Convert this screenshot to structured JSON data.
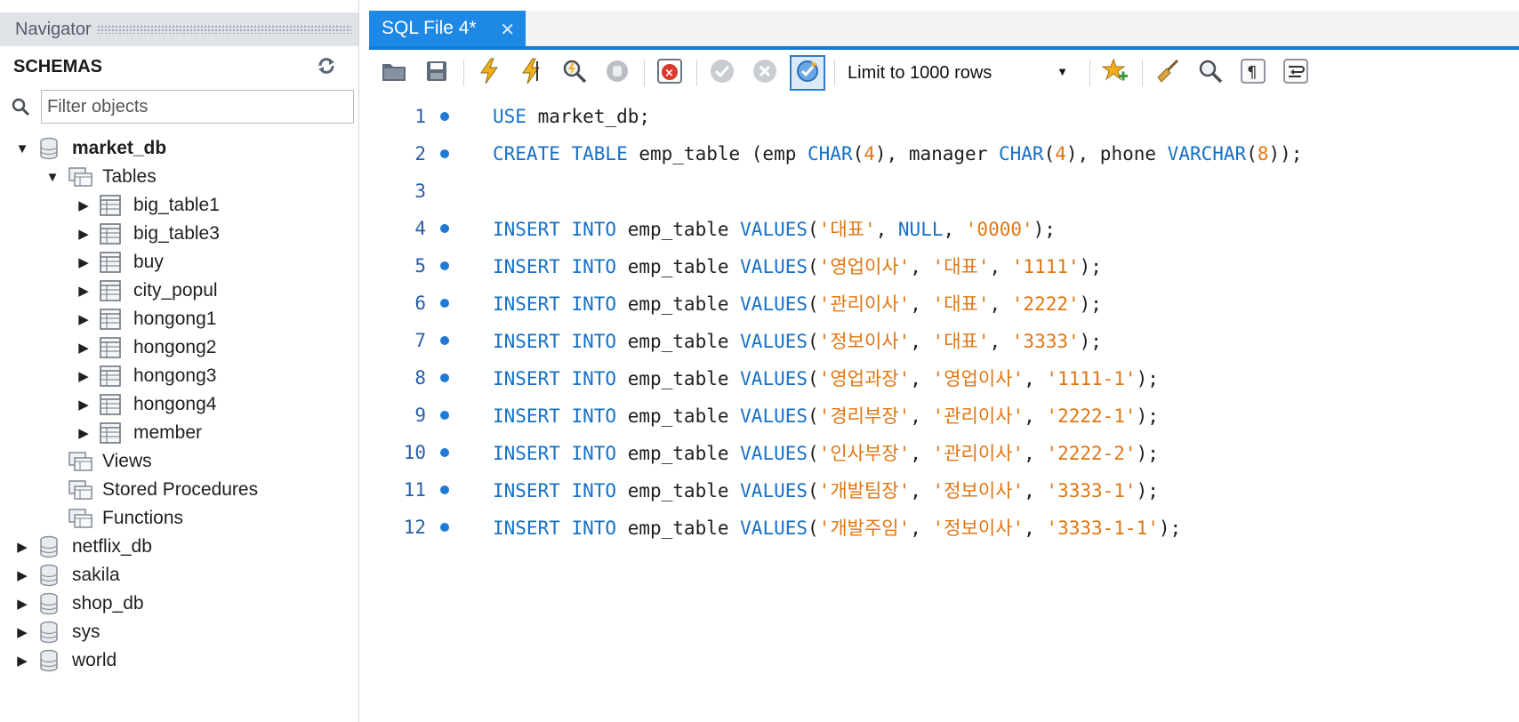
{
  "navigator": {
    "title": "Navigator",
    "schemas_label": "SCHEMAS",
    "filter_placeholder": "Filter objects",
    "tree": [
      {
        "label": "market_db",
        "level": 0,
        "type": "db",
        "expanded": true,
        "bold": true
      },
      {
        "label": "Tables",
        "level": 1,
        "type": "folder",
        "expanded": true
      },
      {
        "label": "big_table1",
        "level": 2,
        "type": "table",
        "expanded": false
      },
      {
        "label": "big_table3",
        "level": 2,
        "type": "table",
        "expanded": false
      },
      {
        "label": "buy",
        "level": 2,
        "type": "table",
        "expanded": false
      },
      {
        "label": "city_popul",
        "level": 2,
        "type": "table",
        "expanded": false
      },
      {
        "label": "hongong1",
        "level": 2,
        "type": "table",
        "expanded": false
      },
      {
        "label": "hongong2",
        "level": 2,
        "type": "table",
        "expanded": false
      },
      {
        "label": "hongong3",
        "level": 2,
        "type": "table",
        "expanded": false
      },
      {
        "label": "hongong4",
        "level": 2,
        "type": "table",
        "expanded": false
      },
      {
        "label": "member",
        "level": 2,
        "type": "table",
        "expanded": false
      },
      {
        "label": "Views",
        "level": 1,
        "type": "folder",
        "leaf": true
      },
      {
        "label": "Stored Procedures",
        "level": 1,
        "type": "folder",
        "leaf": true
      },
      {
        "label": "Functions",
        "level": 1,
        "type": "folder",
        "leaf": true
      },
      {
        "label": "netflix_db",
        "level": 0,
        "type": "db",
        "expanded": false
      },
      {
        "label": "sakila",
        "level": 0,
        "type": "db",
        "expanded": false
      },
      {
        "label": "shop_db",
        "level": 0,
        "type": "db",
        "expanded": false
      },
      {
        "label": "sys",
        "level": 0,
        "type": "db",
        "expanded": false
      },
      {
        "label": "world",
        "level": 0,
        "type": "db",
        "expanded": false
      }
    ]
  },
  "editor": {
    "tab_label": "SQL File 4*",
    "limit_label": "Limit to 1000 rows",
    "lines": [
      {
        "n": "1",
        "dot": true,
        "tokens": [
          [
            "kw",
            "USE"
          ],
          [
            "plain",
            " market_db;"
          ]
        ]
      },
      {
        "n": "2",
        "dot": true,
        "tokens": [
          [
            "kw",
            "CREATE TABLE"
          ],
          [
            "plain",
            " emp_table (emp "
          ],
          [
            "kw",
            "CHAR"
          ],
          [
            "plain",
            "("
          ],
          [
            "num",
            "4"
          ],
          [
            "plain",
            "), manager "
          ],
          [
            "kw",
            "CHAR"
          ],
          [
            "plain",
            "("
          ],
          [
            "num",
            "4"
          ],
          [
            "plain",
            "), phone "
          ],
          [
            "kw",
            "VARCHAR"
          ],
          [
            "plain",
            "("
          ],
          [
            "num",
            "8"
          ],
          [
            "plain",
            "));"
          ]
        ]
      },
      {
        "n": "3",
        "dot": false,
        "tokens": []
      },
      {
        "n": "4",
        "dot": true,
        "tokens": [
          [
            "kw",
            "INSERT INTO"
          ],
          [
            "plain",
            " emp_table "
          ],
          [
            "kw",
            "VALUES"
          ],
          [
            "plain",
            "("
          ],
          [
            "str",
            "'대표'"
          ],
          [
            "plain",
            ", "
          ],
          [
            "kw",
            "NULL"
          ],
          [
            "plain",
            ", "
          ],
          [
            "str",
            "'0000'"
          ],
          [
            "plain",
            ");"
          ]
        ]
      },
      {
        "n": "5",
        "dot": true,
        "tokens": [
          [
            "kw",
            "INSERT INTO"
          ],
          [
            "plain",
            " emp_table "
          ],
          [
            "kw",
            "VALUES"
          ],
          [
            "plain",
            "("
          ],
          [
            "str",
            "'영업이사'"
          ],
          [
            "plain",
            ", "
          ],
          [
            "str",
            "'대표'"
          ],
          [
            "plain",
            ", "
          ],
          [
            "str",
            "'1111'"
          ],
          [
            "plain",
            ");"
          ]
        ]
      },
      {
        "n": "6",
        "dot": true,
        "tokens": [
          [
            "kw",
            "INSERT INTO"
          ],
          [
            "plain",
            " emp_table "
          ],
          [
            "kw",
            "VALUES"
          ],
          [
            "plain",
            "("
          ],
          [
            "str",
            "'관리이사'"
          ],
          [
            "plain",
            ", "
          ],
          [
            "str",
            "'대표'"
          ],
          [
            "plain",
            ", "
          ],
          [
            "str",
            "'2222'"
          ],
          [
            "plain",
            ");"
          ]
        ]
      },
      {
        "n": "7",
        "dot": true,
        "tokens": [
          [
            "kw",
            "INSERT INTO"
          ],
          [
            "plain",
            " emp_table "
          ],
          [
            "kw",
            "VALUES"
          ],
          [
            "plain",
            "("
          ],
          [
            "str",
            "'정보이사'"
          ],
          [
            "plain",
            ", "
          ],
          [
            "str",
            "'대표'"
          ],
          [
            "plain",
            ", "
          ],
          [
            "str",
            "'3333'"
          ],
          [
            "plain",
            ");"
          ]
        ]
      },
      {
        "n": "8",
        "dot": true,
        "tokens": [
          [
            "kw",
            "INSERT INTO"
          ],
          [
            "plain",
            " emp_table "
          ],
          [
            "kw",
            "VALUES"
          ],
          [
            "plain",
            "("
          ],
          [
            "str",
            "'영업과장'"
          ],
          [
            "plain",
            ", "
          ],
          [
            "str",
            "'영업이사'"
          ],
          [
            "plain",
            ", "
          ],
          [
            "str",
            "'1111-1'"
          ],
          [
            "plain",
            ");"
          ]
        ]
      },
      {
        "n": "9",
        "dot": true,
        "tokens": [
          [
            "kw",
            "INSERT INTO"
          ],
          [
            "plain",
            " emp_table "
          ],
          [
            "kw",
            "VALUES"
          ],
          [
            "plain",
            "("
          ],
          [
            "str",
            "'경리부장'"
          ],
          [
            "plain",
            ", "
          ],
          [
            "str",
            "'관리이사'"
          ],
          [
            "plain",
            ", "
          ],
          [
            "str",
            "'2222-1'"
          ],
          [
            "plain",
            ");"
          ]
        ]
      },
      {
        "n": "10",
        "dot": true,
        "tokens": [
          [
            "kw",
            "INSERT INTO"
          ],
          [
            "plain",
            " emp_table "
          ],
          [
            "kw",
            "VALUES"
          ],
          [
            "plain",
            "("
          ],
          [
            "str",
            "'인사부장'"
          ],
          [
            "plain",
            ", "
          ],
          [
            "str",
            "'관리이사'"
          ],
          [
            "plain",
            ", "
          ],
          [
            "str",
            "'2222-2'"
          ],
          [
            "plain",
            ");"
          ]
        ]
      },
      {
        "n": "11",
        "dot": true,
        "tokens": [
          [
            "kw",
            "INSERT INTO"
          ],
          [
            "plain",
            " emp_table "
          ],
          [
            "kw",
            "VALUES"
          ],
          [
            "plain",
            "("
          ],
          [
            "str",
            "'개발팀장'"
          ],
          [
            "plain",
            ", "
          ],
          [
            "str",
            "'정보이사'"
          ],
          [
            "plain",
            ", "
          ],
          [
            "str",
            "'3333-1'"
          ],
          [
            "plain",
            ");"
          ]
        ]
      },
      {
        "n": "12",
        "dot": true,
        "tokens": [
          [
            "kw",
            "INSERT INTO"
          ],
          [
            "plain",
            " emp_table "
          ],
          [
            "kw",
            "VALUES"
          ],
          [
            "plain",
            "("
          ],
          [
            "str",
            "'개발주임'"
          ],
          [
            "plain",
            ", "
          ],
          [
            "str",
            "'정보이사'"
          ],
          [
            "plain",
            ", "
          ],
          [
            "str",
            "'3333-1-1'"
          ],
          [
            "plain",
            ");"
          ]
        ]
      }
    ]
  },
  "colors": {
    "keyword": "#1670c6",
    "string": "#e07612",
    "tab_active": "#1e88e5"
  }
}
